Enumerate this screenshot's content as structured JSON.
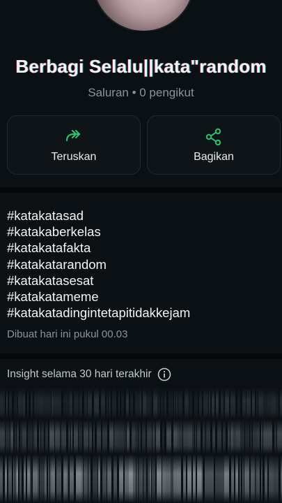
{
  "channel": {
    "name": "Berbagi Selalu||kata\"random",
    "meta": "Saluran • 0 pengikut"
  },
  "actions": {
    "forward_label": "Teruskan",
    "share_label": "Bagikan",
    "forward_icon": "forward-icon",
    "share_icon": "share-icon",
    "accent_color": "#2fbf71"
  },
  "post": {
    "lines": [
      "#katakatasad",
      "#katakaberkelas",
      "#katakatafakta",
      "#katakatarandom",
      "#katakatasesat",
      "#katakatameme",
      "#katakatadingintetapitidakkejam"
    ],
    "timestamp": "Dibuat hari ini pukul 00.03"
  },
  "insights": {
    "label": "Insight selama 30 hari terakhir",
    "info_icon": "info-icon"
  }
}
